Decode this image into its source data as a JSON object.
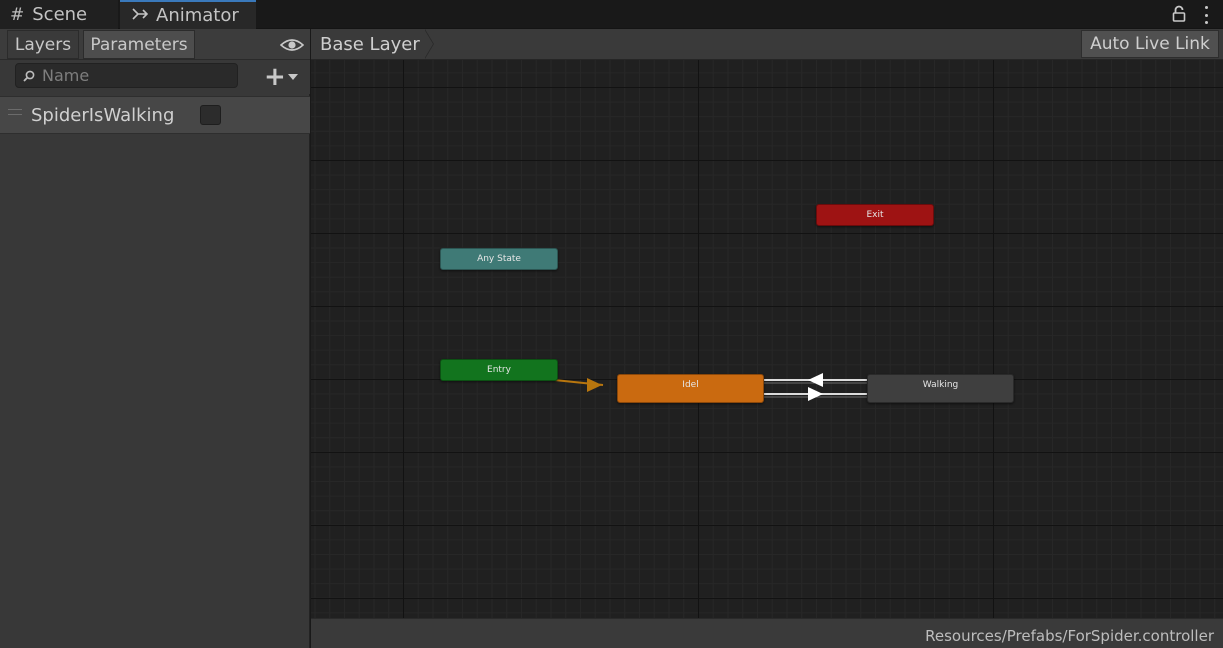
{
  "tabs": {
    "scene": {
      "label": "Scene",
      "icon": "hash-icon"
    },
    "animator": {
      "label": "Animator",
      "icon": "animator-icon"
    }
  },
  "window_controls": {
    "lock_icon": "lock-icon",
    "menu_icon": "kebab-icon"
  },
  "left_panel": {
    "tabs": [
      {
        "label": "Layers",
        "active": false
      },
      {
        "label": "Parameters",
        "active": true
      }
    ],
    "visibility_icon": "eye-icon",
    "search": {
      "placeholder": "Name",
      "value": ""
    },
    "parameters": [
      {
        "name": "SpiderIsWalking",
        "type": "bool",
        "value": false
      }
    ]
  },
  "graph_toolbar": {
    "breadcrumb": "Base Layer",
    "auto_live_link_label": "Auto Live Link"
  },
  "graph": {
    "states": {
      "exit": {
        "label": "Exit",
        "color": "#9e1313"
      },
      "any_state": {
        "label": "Any State",
        "color": "#3f7a76"
      },
      "entry": {
        "label": "Entry",
        "color": "#12741e"
      },
      "idel": {
        "label": "Idel",
        "color": "#ca6a10"
      },
      "walking": {
        "label": "Walking",
        "color": "#3f3f3f"
      }
    },
    "transitions": [
      {
        "from": "Entry",
        "to": "Idel",
        "color": "#b8760e"
      },
      {
        "from": "Idel",
        "to": "Walking",
        "color": "#e0e0e0"
      },
      {
        "from": "Walking",
        "to": "Idel",
        "color": "#e0e0e0"
      }
    ]
  },
  "status_bar": {
    "path": "Resources/Prefabs/ForSpider.controller"
  }
}
